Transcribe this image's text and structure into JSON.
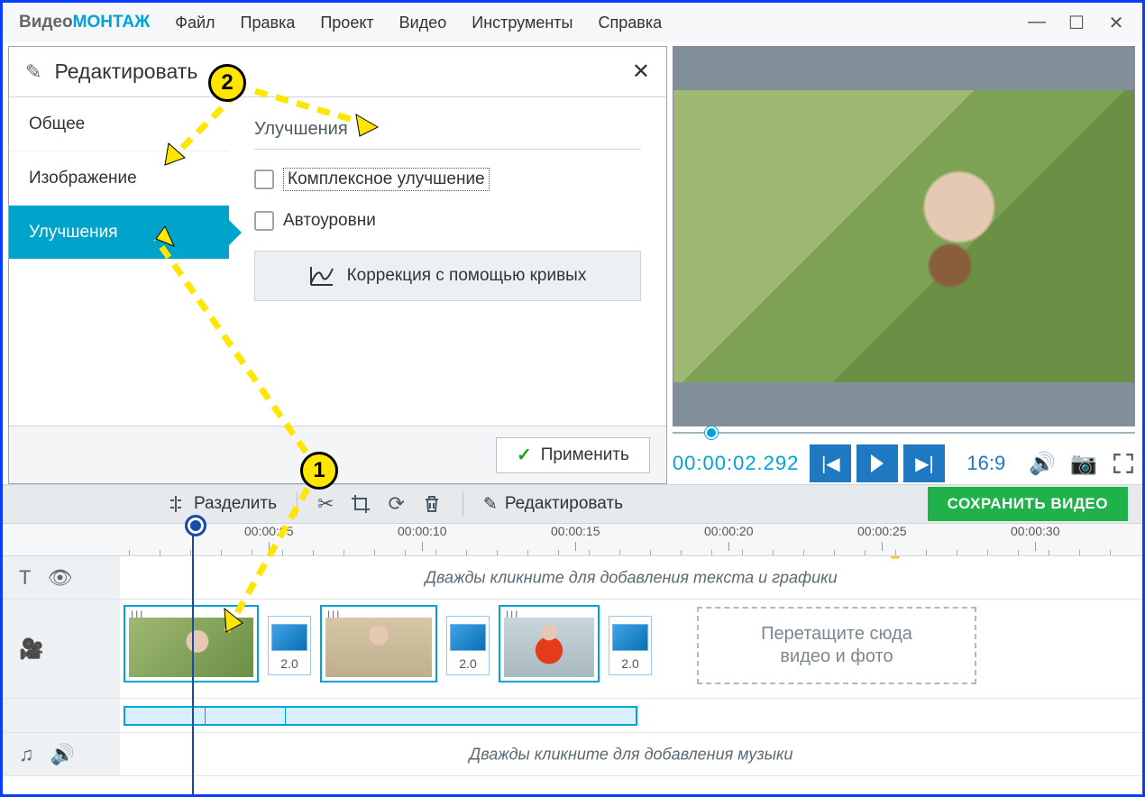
{
  "app_title": {
    "a": "Видео",
    "b": "МОНТАЖ"
  },
  "menus": [
    "Файл",
    "Правка",
    "Проект",
    "Видео",
    "Инструменты",
    "Справка"
  ],
  "edit_panel": {
    "title": "Редактировать",
    "tabs": {
      "general": "Общее",
      "image": "Изображение",
      "improve": "Улучшения"
    },
    "section_title": "Улучшения",
    "cb_complex": "Комплексное улучшение",
    "cb_auto": "Автоуровни",
    "curves_btn": "Коррекция с помощью кривых",
    "apply": "Применить"
  },
  "preview": {
    "timecode": "00:00:02.292",
    "aspect": "16:9"
  },
  "tl_toolbar": {
    "split": "Разделить",
    "edit": "Редактировать",
    "save": "СОХРАНИТЬ ВИДЕО"
  },
  "ruler": [
    "00:00:05",
    "00:00:10",
    "00:00:15",
    "00:00:20",
    "00:00:25",
    "00:00:30"
  ],
  "tracks": {
    "text_hint": "Дважды кликните для добавления текста и графики",
    "music_hint": "Дважды кликните для добавления музыки",
    "drop_hint": "Перетащите сюда\nвидео и фото",
    "trans_dur": "2.0"
  },
  "badges": {
    "one": "1",
    "two": "2"
  }
}
